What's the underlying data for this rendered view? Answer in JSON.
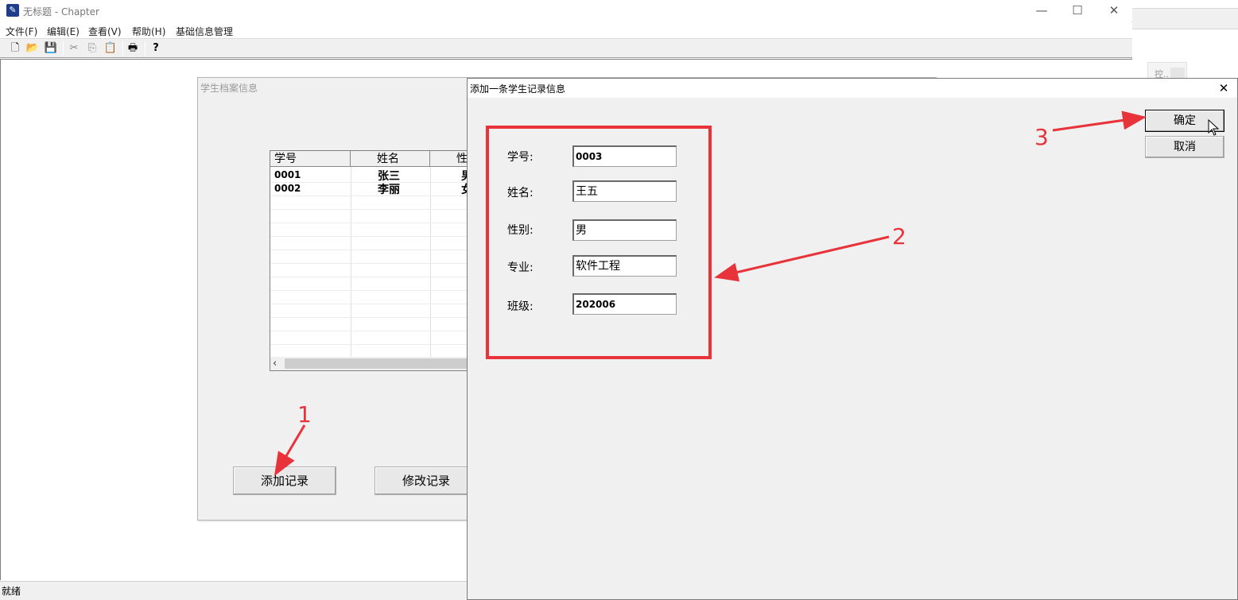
{
  "app": {
    "title": "无标题 - Chapter",
    "icon": "app-icon",
    "window_controls": {
      "minimize": "—",
      "maximize": "☐",
      "close": "✕"
    },
    "menus": [
      "文件(F)",
      "编辑(E)",
      "查看(V)",
      "帮助(H)",
      "基础信息管理"
    ],
    "toolbar": [
      {
        "name": "new-icon",
        "glyph": "🗋"
      },
      {
        "name": "open-icon",
        "glyph": "📂"
      },
      {
        "name": "save-icon",
        "glyph": "💾"
      },
      {
        "name": "cut-icon",
        "glyph": "✂"
      },
      {
        "name": "copy-icon",
        "glyph": "⎘"
      },
      {
        "name": "paste-icon",
        "glyph": "📋"
      },
      {
        "name": "print-icon",
        "glyph": "🖶"
      },
      {
        "name": "help-icon",
        "glyph": "?"
      }
    ],
    "status": "就绪"
  },
  "background_window": {
    "label": "控.."
  },
  "student_window": {
    "title": "学生档案信息",
    "grid": {
      "columns": [
        "学号",
        "姓名",
        "性"
      ],
      "rows": [
        [
          "0001",
          "张三",
          "男"
        ],
        [
          "0002",
          "李丽",
          "女"
        ]
      ]
    },
    "buttons": {
      "add": "添加记录",
      "edit": "修改记录"
    }
  },
  "dialog": {
    "title": "添加一条学生记录信息",
    "close": "✕",
    "fields": [
      {
        "label": "学号:",
        "value": "0003"
      },
      {
        "label": "姓名:",
        "value": "王五"
      },
      {
        "label": "性别:",
        "value": "男"
      },
      {
        "label": "专业:",
        "value": "软件工程"
      },
      {
        "label": "班级:",
        "value": "202006"
      }
    ],
    "ok": "确定",
    "cancel": "取消"
  },
  "annotations": {
    "color": "#e8333a",
    "step1": "1",
    "step2": "2",
    "step3": "3"
  }
}
